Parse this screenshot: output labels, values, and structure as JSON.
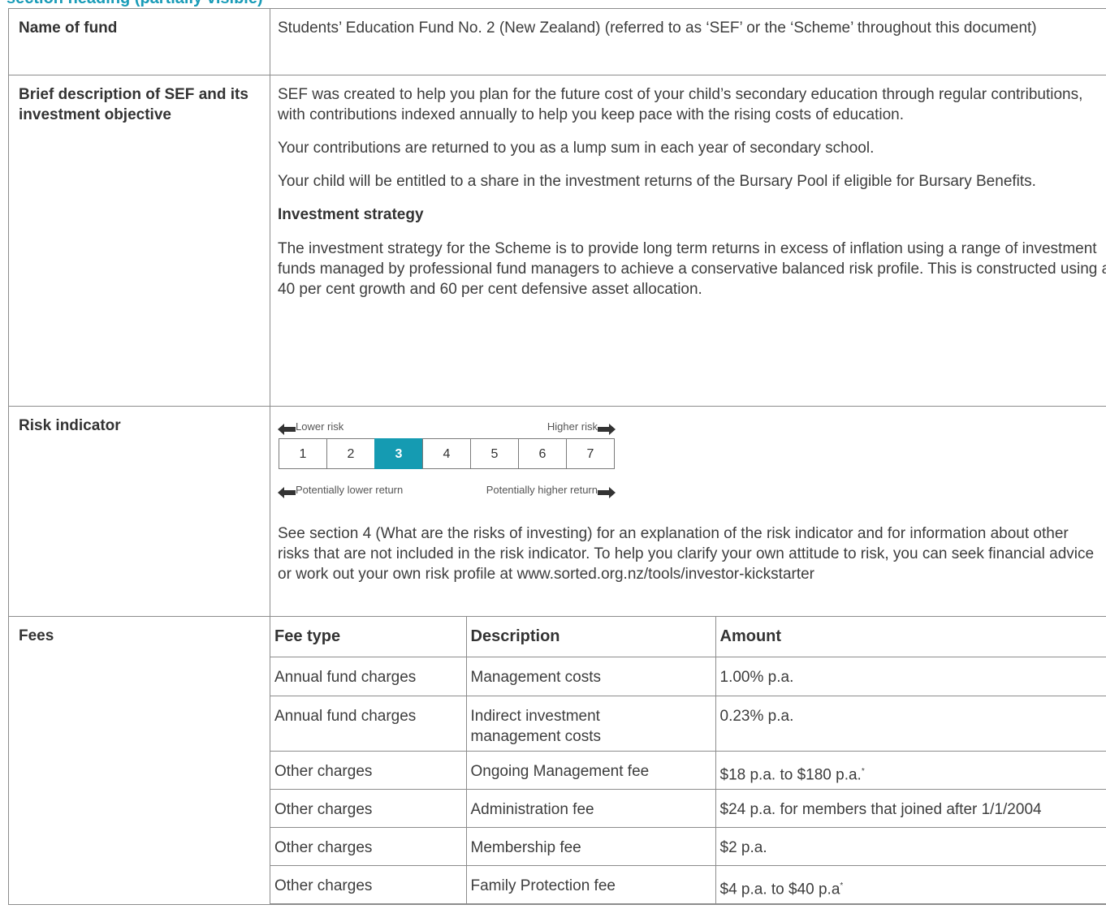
{
  "section_heading": "section heading (partially visible)",
  "rows": {
    "name_of_fund": {
      "label": "Name of fund",
      "text": "Students’ Education Fund No. 2 (New Zealand) (referred to as ‘SEF’ or the ‘Scheme’ throughout this document)"
    },
    "description": {
      "label": "Brief description of SEF and its investment objective",
      "paragraphs": [
        "SEF was created to help you plan for the future cost of your child’s secondary education through regular contributions, with contributions indexed annually to help you keep pace with the rising costs of education.",
        "Your contributions are returned to you as a lump sum in each year of secondary school.",
        "Your child will be entitled to a share in the investment returns of the Bursary Pool if eligible for Bursary Benefits."
      ],
      "strategy_heading": "Investment strategy",
      "strategy_text": "The investment strategy for the Scheme is to provide long term returns in excess of inflation using a range of investment funds managed by professional fund managers to achieve a conservative balanced risk profile. This is constructed using a 40 per cent growth and 60 per cent defensive asset allocation."
    },
    "risk": {
      "label": "Risk indicator",
      "lower_risk": "Lower risk",
      "higher_risk": "Higher risk",
      "lower_return": "Potentially lower return",
      "higher_return": "Potentially higher return",
      "scale": [
        "1",
        "2",
        "3",
        "4",
        "5",
        "6",
        "7"
      ],
      "selected": "3",
      "accent_color": "#159bb2",
      "note": "See section 4 (What are the risks of investing) for an explanation of the risk indicator and for information about other risks that are not included in the risk indicator. To help you clarify your own attitude to risk, you can seek financial advice or work out your own risk profile at  www.sorted.org.nz/tools/investor-kickstarter"
    },
    "fees": {
      "label": "Fees",
      "headers": [
        "Fee type",
        "Description",
        "Amount"
      ],
      "rows": [
        [
          "Annual fund charges",
          "Management costs",
          "1.00% p.a."
        ],
        [
          "Annual fund charges",
          "Indirect investment management costs",
          "0.23% p.a."
        ],
        [
          "Other charges",
          "Ongoing Management fee",
          "$18 p.a. to $180 p.a."
        ],
        [
          "Other charges",
          "Administration fee",
          "$24 p.a. for members that joined after 1/1/2004"
        ],
        [
          "Other charges",
          "Membership fee",
          "$2 p.a."
        ],
        [
          "Other charges",
          "Family Protection fee",
          "$4 p.a. to $40 p.a"
        ]
      ],
      "footnote_mark": "*"
    }
  }
}
